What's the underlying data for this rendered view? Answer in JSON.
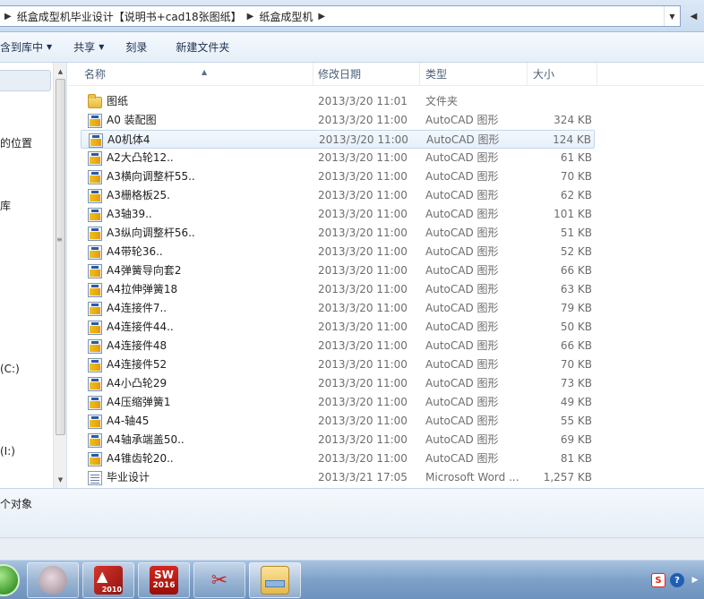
{
  "address": {
    "crumbs": [
      "纸盒成型机毕业设计【说明书+cad18张图纸】",
      "纸盒成型机"
    ]
  },
  "toolbar": {
    "include_label": "含到库中",
    "share_label": "共享",
    "burn_label": "刻录",
    "new_folder_label": "新建文件夹"
  },
  "nav": {
    "items": [
      {
        "label": "的位置"
      },
      {
        "label": "库"
      },
      {
        "label": "(C:)"
      },
      {
        "label": "(I:)"
      }
    ]
  },
  "columns": {
    "name": "名称",
    "date": "修改日期",
    "type": "类型",
    "size": "大小"
  },
  "files": [
    {
      "name": "图纸",
      "date": "2013/3/20 11:01",
      "type": "文件夹",
      "size": "",
      "icon": "folder-icon"
    },
    {
      "name": "A0 装配图",
      "date": "2013/3/20 11:00",
      "type": "AutoCAD 图形",
      "size": "324 KB",
      "icon": "dwg-file-icon"
    },
    {
      "name": "A0机体4",
      "date": "2013/3/20 11:00",
      "type": "AutoCAD 图形",
      "size": "124 KB",
      "icon": "dwg-file-icon"
    },
    {
      "name": "A2大凸轮12..",
      "date": "2013/3/20 11:00",
      "type": "AutoCAD 图形",
      "size": "61 KB",
      "icon": "dwg-file-icon"
    },
    {
      "name": "A3横向调整杆55..",
      "date": "2013/3/20 11:00",
      "type": "AutoCAD 图形",
      "size": "70 KB",
      "icon": "dwg-file-icon"
    },
    {
      "name": "A3栅格板25.",
      "date": "2013/3/20 11:00",
      "type": "AutoCAD 图形",
      "size": "62 KB",
      "icon": "dwg-file-icon"
    },
    {
      "name": "A3轴39..",
      "date": "2013/3/20 11:00",
      "type": "AutoCAD 图形",
      "size": "101 KB",
      "icon": "dwg-file-icon"
    },
    {
      "name": "A3纵向调整杆56..",
      "date": "2013/3/20 11:00",
      "type": "AutoCAD 图形",
      "size": "51 KB",
      "icon": "dwg-file-icon"
    },
    {
      "name": "A4带轮36..",
      "date": "2013/3/20 11:00",
      "type": "AutoCAD 图形",
      "size": "52 KB",
      "icon": "dwg-file-icon"
    },
    {
      "name": "A4弹簧导向套2",
      "date": "2013/3/20 11:00",
      "type": "AutoCAD 图形",
      "size": "66 KB",
      "icon": "dwg-file-icon"
    },
    {
      "name": "A4拉伸弹簧18",
      "date": "2013/3/20 11:00",
      "type": "AutoCAD 图形",
      "size": "63 KB",
      "icon": "dwg-file-icon"
    },
    {
      "name": "A4连接件7..",
      "date": "2013/3/20 11:00",
      "type": "AutoCAD 图形",
      "size": "79 KB",
      "icon": "dwg-file-icon"
    },
    {
      "name": "A4连接件44..",
      "date": "2013/3/20 11:00",
      "type": "AutoCAD 图形",
      "size": "50 KB",
      "icon": "dwg-file-icon"
    },
    {
      "name": "A4连接件48",
      "date": "2013/3/20 11:00",
      "type": "AutoCAD 图形",
      "size": "66 KB",
      "icon": "dwg-file-icon"
    },
    {
      "name": "A4连接件52",
      "date": "2013/3/20 11:00",
      "type": "AutoCAD 图形",
      "size": "70 KB",
      "icon": "dwg-file-icon"
    },
    {
      "name": "A4小凸轮29",
      "date": "2013/3/20 11:00",
      "type": "AutoCAD 图形",
      "size": "73 KB",
      "icon": "dwg-file-icon"
    },
    {
      "name": "A4压缩弹簧1",
      "date": "2013/3/20 11:00",
      "type": "AutoCAD 图形",
      "size": "49 KB",
      "icon": "dwg-file-icon"
    },
    {
      "name": "A4-轴45",
      "date": "2013/3/20 11:00",
      "type": "AutoCAD 图形",
      "size": "55 KB",
      "icon": "dwg-file-icon"
    },
    {
      "name": "A4轴承端盖50..",
      "date": "2013/3/20 11:00",
      "type": "AutoCAD 图形",
      "size": "69 KB",
      "icon": "dwg-file-icon"
    },
    {
      "name": "A4锥齿轮20..",
      "date": "2013/3/20 11:00",
      "type": "AutoCAD 图形",
      "size": "81 KB",
      "icon": "dwg-file-icon"
    },
    {
      "name": "毕业设计",
      "date": "2013/3/21 17:05",
      "type": "Microsoft Word ...",
      "size": "1,257 KB",
      "icon": "word-doc-icon"
    }
  ],
  "selected_file": "A0机体4",
  "status": {
    "text": "个对象"
  },
  "taskbar": {
    "solidworks_label": "2016",
    "autocad_label": "2010"
  },
  "tray": {
    "ime_label": "S",
    "help_label": "?"
  }
}
